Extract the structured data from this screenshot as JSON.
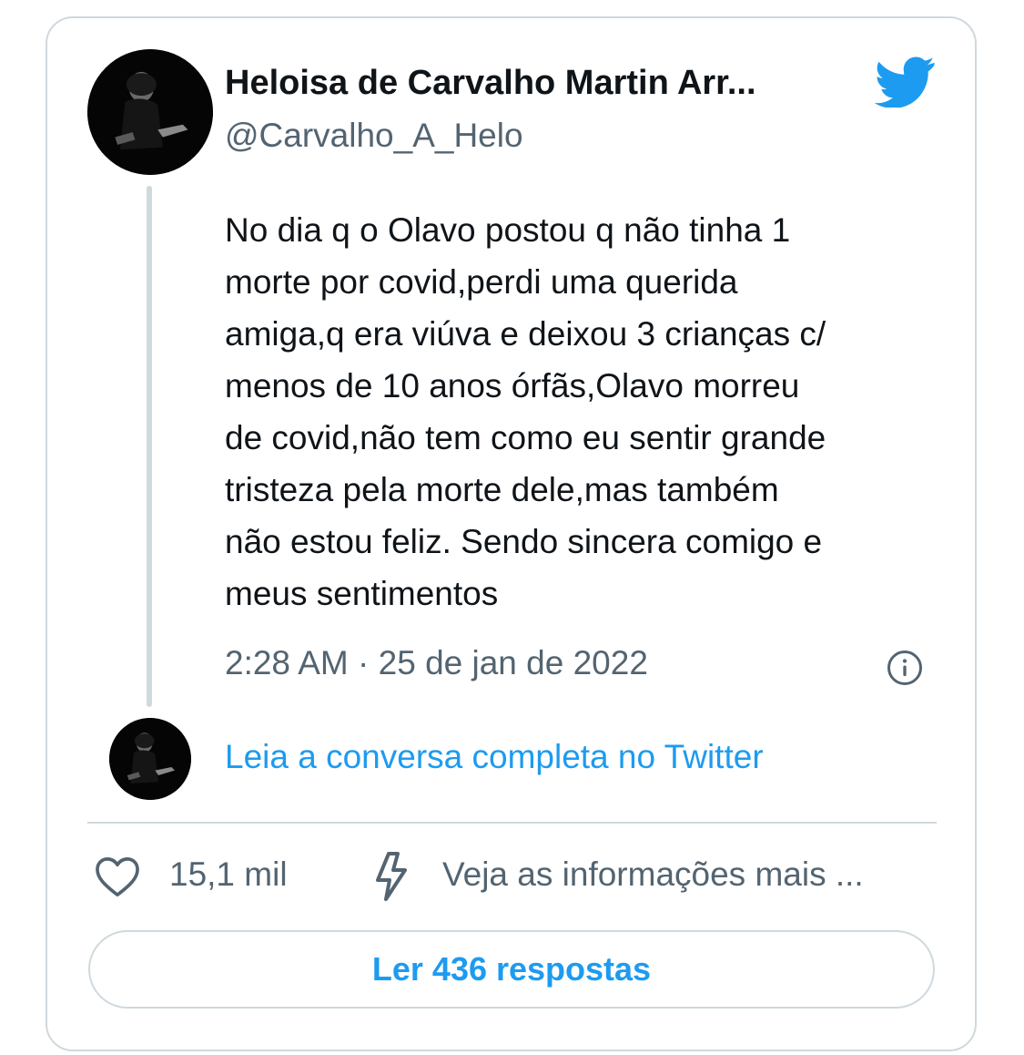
{
  "tweet": {
    "display_name": "Heloisa de Carvalho Martin Arr...",
    "handle": "@Carvalho_A_Helo",
    "text": "No dia q o Olavo postou q não tinha 1\nmorte por covid,perdi uma querida\namiga,q era viúva e deixou 3 crianças c/\nmenos de 10 anos órfãs,Olavo morreu\nde covid,não tem como eu sentir grande\ntristeza pela morte dele,mas também\nnão estou feliz. Sendo sincera comigo e\nmeus sentimentos",
    "timestamp": "2:28 AM · 25 de jan de 2022",
    "read_conversation": "Leia a conversa completa no Twitter",
    "like_count": "15,1 mil",
    "more_info": "Veja as informações mais ...",
    "replies_button": "Ler 436 respostas"
  },
  "icons": {
    "brand": "twitter-bird-icon",
    "info": "info-icon",
    "like": "heart-icon",
    "more": "lightning-bolt-icon"
  },
  "colors": {
    "accent": "#1d9bf0",
    "text_primary": "#0f1419",
    "text_secondary": "#536471",
    "border": "#cfd9de"
  }
}
